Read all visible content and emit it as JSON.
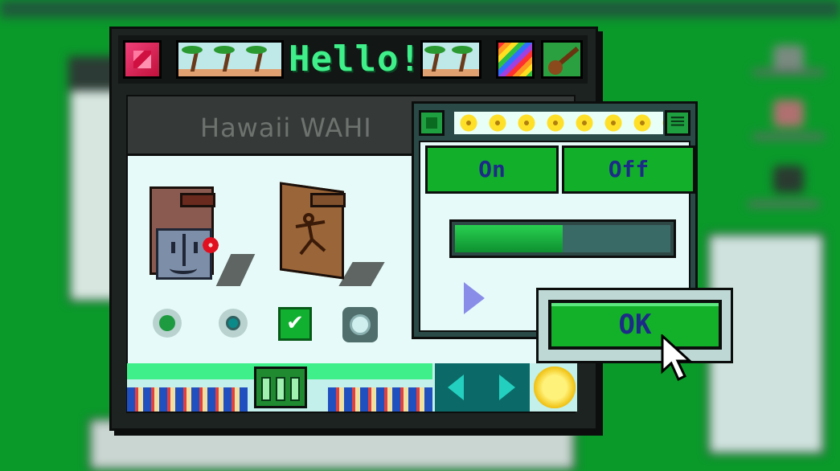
{
  "window": {
    "title": "Hello!"
  },
  "header": {
    "text": "Hawaii WAHI"
  },
  "panel": {
    "on_label": "On",
    "off_label": "Off",
    "progress_fraction": 0.5
  },
  "dialog": {
    "ok_label": "OK"
  },
  "colors": {
    "desktop": "#0a9a2a",
    "accent_green": "#3ff08a",
    "button_green": "#13b02a",
    "button_text": "#1d2a88"
  },
  "icons": [
    "close-box-icon",
    "palm-tree-icon",
    "rainbow-icon",
    "ukulele-icon",
    "finder-folder-icon",
    "stick-figure-folder-icon",
    "checkbox-icon",
    "left-arrow-icon",
    "right-arrow-icon",
    "flower-icon",
    "cursor-icon"
  ]
}
